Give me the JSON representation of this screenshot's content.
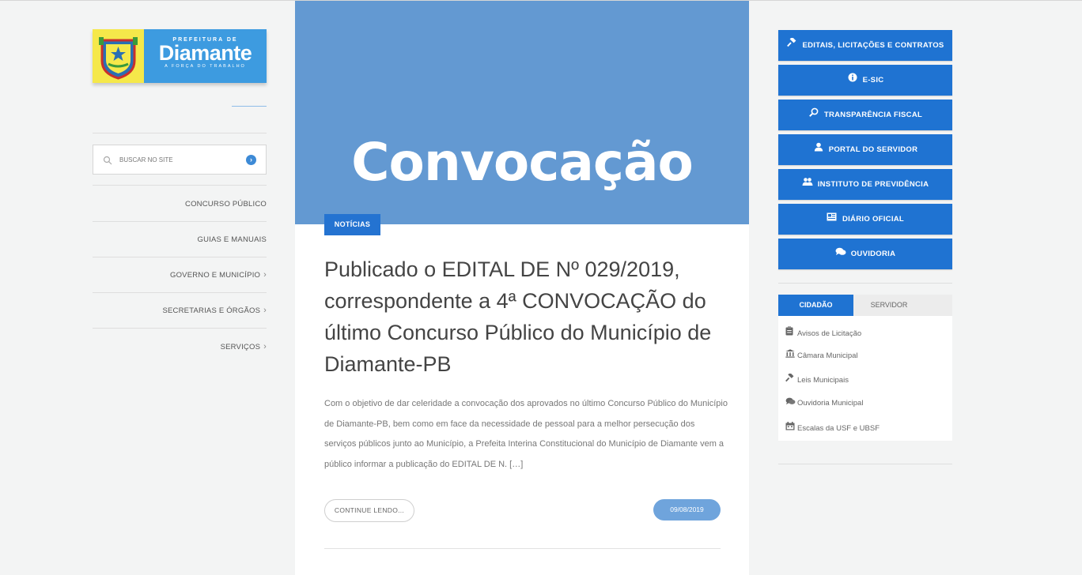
{
  "logo": {
    "pre": "PREFEITURA DE",
    "name": "Diamante",
    "motto": "A FORÇA DO TRABALHO"
  },
  "search": {
    "placeholder": "BUSCAR NO SITE"
  },
  "left_menu": [
    {
      "label": "CONCURSO PÚBLICO",
      "chevron": ""
    },
    {
      "label": "GUIAS E MANUAIS",
      "chevron": ""
    },
    {
      "label": "GOVERNO E MUNICÍPIO",
      "chevron": "›"
    },
    {
      "label": "SECRETARIAS E ÓRGÃOS",
      "chevron": "›"
    },
    {
      "label": "SERVIÇOS",
      "chevron": "›"
    }
  ],
  "post": {
    "hero_text": "Convocação",
    "category": "NOTÍCIAS",
    "title": "Publicado o EDITAL DE Nº 029/2019, correspondente a 4ª CONVOCAÇÃO do último Concurso Público do Município de Diamante-PB",
    "excerpt": "Com o objetivo de dar celeridade a convocação dos aprovados no último Concurso Público do Município de Diamante-PB, bem como em face da necessidade de pessoal para a melhor persecução dos serviços públicos junto ao Município, a Prefeita Interina Constitucional do Município de Diamante vem a público informar a publicação do EDITAL DE N. […]",
    "read_more": "CONTINUE LENDO...",
    "date": "09/08/2019"
  },
  "right_buttons": [
    {
      "label": "EDITAIS, LICITAÇÕES E CONTRATOS",
      "icon": "gavel-icon"
    },
    {
      "label": "E-SIC",
      "icon": "info-icon"
    },
    {
      "label": "TRANSPARÊNCIA FISCAL",
      "icon": "search-icon"
    },
    {
      "label": "PORTAL DO SERVIDOR",
      "icon": "user-icon"
    },
    {
      "label": "INSTITUTO DE PREVIDÊNCIA",
      "icon": "users-icon"
    },
    {
      "label": "DIÁRIO OFICIAL",
      "icon": "newspaper-icon"
    },
    {
      "label": "OUVIDORIA",
      "icon": "comments-icon"
    }
  ],
  "tabs": {
    "active": "CIDADÃO",
    "inactive": "SERVIDOR"
  },
  "citizen_links": [
    {
      "label": "Avisos de Licitação",
      "icon": "clipboard-icon"
    },
    {
      "label": "Câmara Municipal",
      "icon": "bank-icon"
    },
    {
      "label": "Leis Municipais",
      "icon": "gavel-icon"
    },
    {
      "label": "Ouvidoria Municipal",
      "icon": "comments-icon"
    },
    {
      "label": "Escalas da USF e UBSF",
      "icon": "calendar-icon"
    }
  ],
  "colors": {
    "primary": "#1f73d2",
    "hero": "#6399d2",
    "logo_yellow": "#f5e84a",
    "logo_blue": "#3d9be0"
  }
}
